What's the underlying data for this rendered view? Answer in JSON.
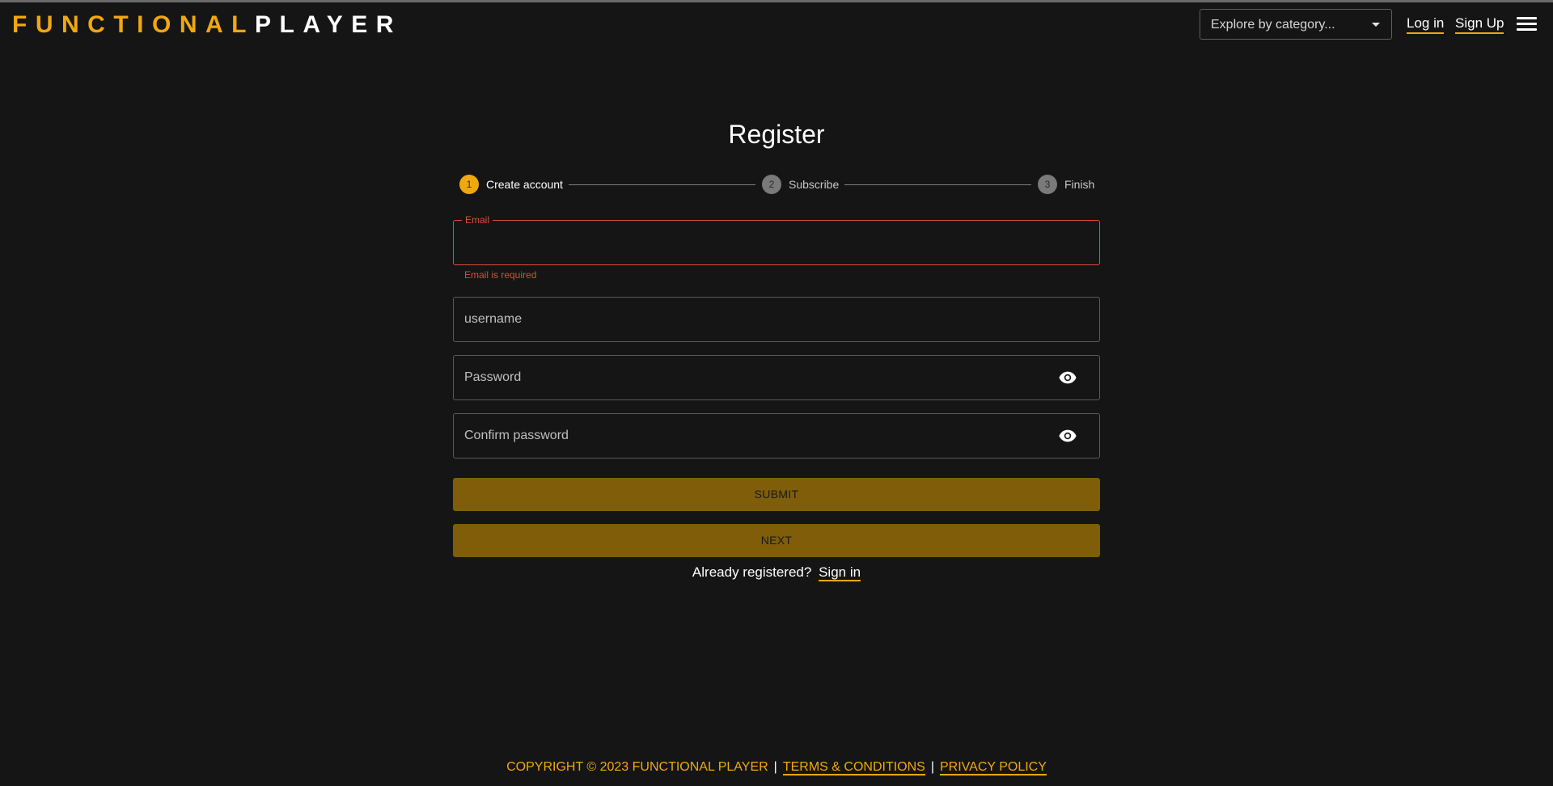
{
  "header": {
    "logo_part1": "FUNCTIONAL",
    "logo_part2": "PLAYER",
    "category_select": {
      "value": "Explore by category..."
    },
    "login_label": "Log in",
    "signup_label": "Sign Up",
    "menu_icon": "hamburger-menu-icon"
  },
  "main": {
    "title": "Register",
    "steps": [
      {
        "number": "1",
        "label": "Create account",
        "state": "active"
      },
      {
        "number": "2",
        "label": "Subscribe",
        "state": "inactive"
      },
      {
        "number": "3",
        "label": "Finish",
        "state": "inactive"
      }
    ],
    "fields": {
      "email": {
        "label": "Email",
        "value": "",
        "error": "Email is required"
      },
      "username": {
        "placeholder": "username",
        "value": ""
      },
      "password": {
        "placeholder": "Password",
        "value": "",
        "icon": "eye-icon"
      },
      "confirm_password": {
        "placeholder": "Confirm password",
        "value": "",
        "icon": "eye-icon"
      }
    },
    "submit_label": "SUBMIT",
    "next_label": "NEXT",
    "already_text": "Already registered?",
    "signin_label": "Sign in"
  },
  "footer": {
    "copyright": "COPYRIGHT © 2023 FUNCTIONAL PLAYER",
    "separator": "|",
    "terms_label": "TERMS & CONDITIONS",
    "privacy_label": "PRIVACY POLICY"
  },
  "colors": {
    "background": "#151515",
    "accent": "#f0a80f",
    "button": "#7f5d09",
    "error": "#e04b3a"
  }
}
